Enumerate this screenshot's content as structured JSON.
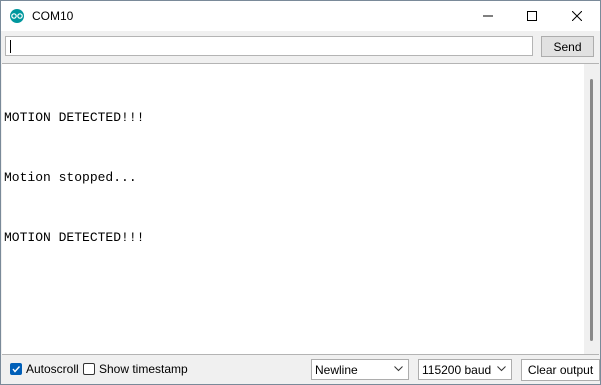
{
  "window": {
    "title": "COM10",
    "app_icon": "arduino-icon",
    "accent": "#00979d"
  },
  "send_bar": {
    "input_value": "",
    "send_label": "Send"
  },
  "output": {
    "lines": [
      "MOTION DETECTED!!!",
      "Motion stopped...",
      "MOTION DETECTED!!!"
    ]
  },
  "status_bar": {
    "autoscroll": {
      "label": "Autoscroll",
      "checked": true
    },
    "timestamp": {
      "label": "Show timestamp",
      "checked": false
    },
    "line_ending": {
      "selected": "Newline"
    },
    "baud_rate": {
      "selected": "115200 baud"
    },
    "clear_label": "Clear output"
  }
}
